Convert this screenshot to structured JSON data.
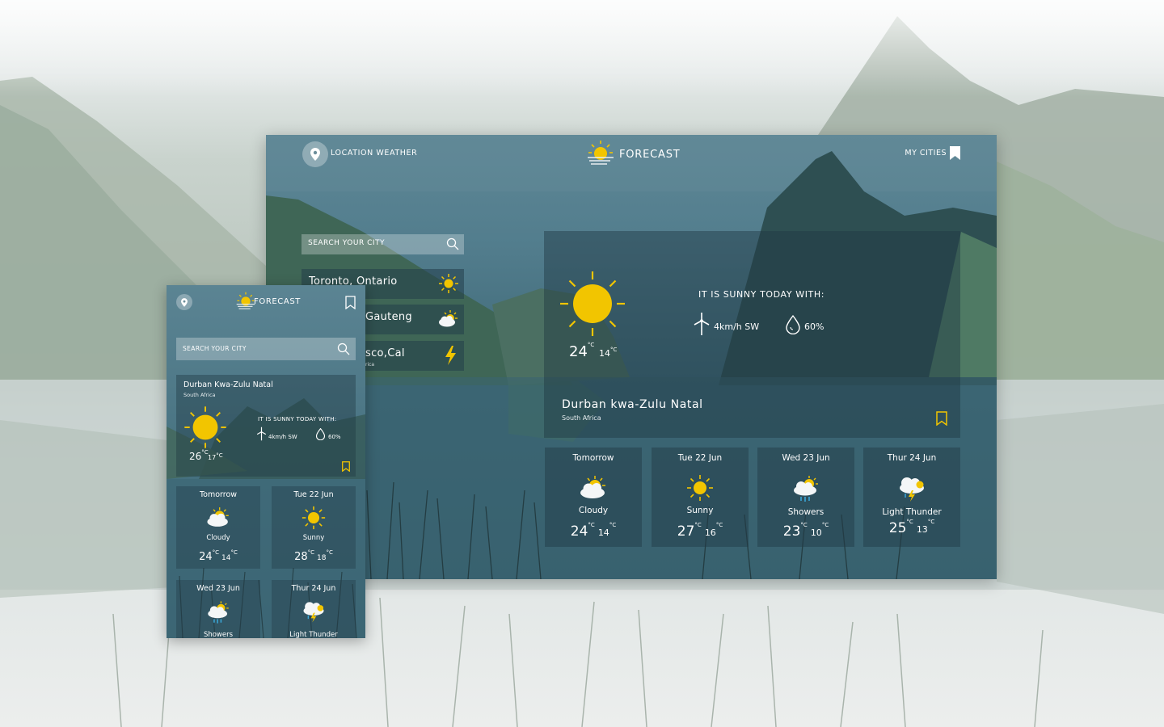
{
  "desktop": {
    "location_label": "LOCATION WEATHER",
    "app_title": "FORECAST",
    "my_cities_label": "MY CITIES",
    "search_placeholder": "SEARCH YOUR CITY",
    "cities": [
      {
        "name": "Toronto, Ontario",
        "sub": "",
        "icon": "sun-icon"
      },
      {
        "name": "Gauteng",
        "sub": "",
        "icon": "partly-cloudy-icon"
      },
      {
        "name": "sco,Cal",
        "sub": "rica",
        "icon": "lightning-icon"
      }
    ],
    "current": {
      "high": "24",
      "low": "14",
      "unit": "°C",
      "summary": "IT IS SUNNY TODAY WITH:",
      "wind": "4km/h SW",
      "humidity": "60%",
      "city": "Durban kwa-Zulu Natal",
      "country": "South Africa"
    },
    "forecast": [
      {
        "day": "Tomorrow",
        "condition": "Cloudy",
        "high": "24",
        "low": "14",
        "icon": "cloudy-icon"
      },
      {
        "day": "Tue 22 Jun",
        "condition": "Sunny",
        "high": "27",
        "low": "16",
        "icon": "sun-icon"
      },
      {
        "day": "Wed 23 Jun",
        "condition": "Showers",
        "high": "23",
        "low": "10",
        "icon": "showers-icon"
      },
      {
        "day": "Thur 24 Jun",
        "condition": "Light Thunder",
        "high": "25",
        "low": "13",
        "icon": "thunder-icon"
      }
    ]
  },
  "mobile": {
    "app_title": "FORECAST",
    "search_placeholder": "SEARCH YOUR CITY",
    "current": {
      "city": "Durban Kwa-Zulu Natal",
      "country": "South Africa",
      "summary": "IT IS SUNNY TODAY WITH:",
      "wind": "4km/h SW",
      "humidity": "60%",
      "high": "26",
      "low": "17",
      "unit": "°C"
    },
    "forecast": [
      {
        "day": "Tomorrow",
        "condition": "Cloudy",
        "high": "24",
        "low": "14"
      },
      {
        "day": "Tue 22 Jun",
        "condition": "Sunny",
        "high": "28",
        "low": "18"
      },
      {
        "day": "Wed 23 Jun",
        "condition": "Showers",
        "high": "",
        "low": ""
      },
      {
        "day": "Thur 24 Jun",
        "condition": "Light Thunder",
        "high": "",
        "low": ""
      }
    ]
  },
  "colors": {
    "accent": "#f2c500",
    "panel": "#2c4f5e",
    "rain": "#3aa7d8"
  }
}
